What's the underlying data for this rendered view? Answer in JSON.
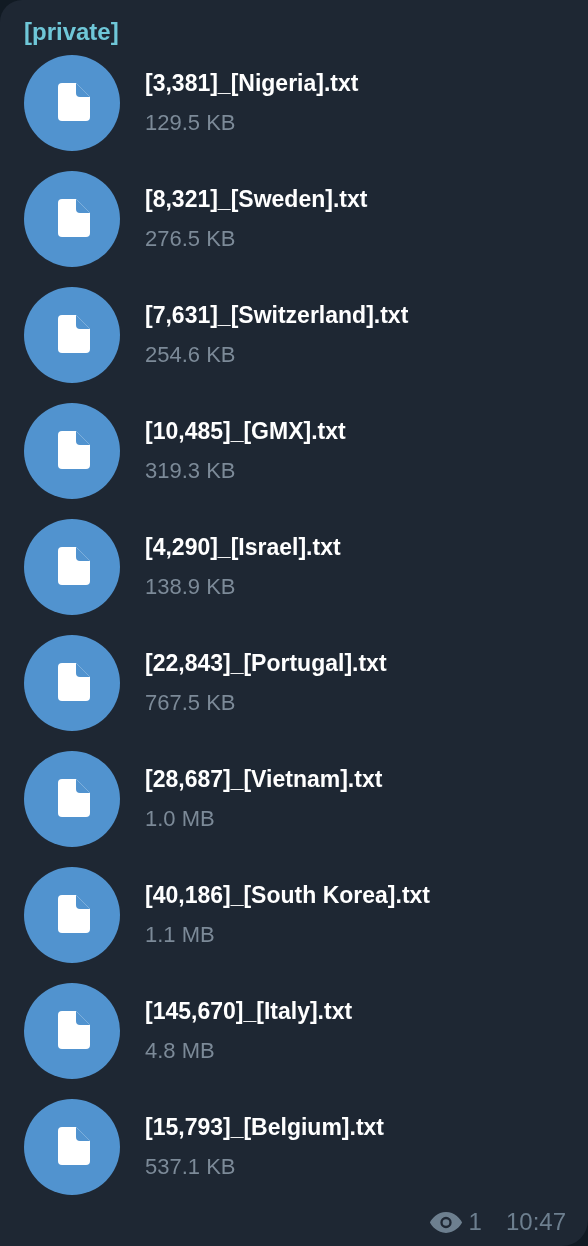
{
  "sender": "[private]",
  "files": [
    {
      "name": "[3,381]_[Nigeria].txt",
      "size": "129.5 KB"
    },
    {
      "name": "[8,321]_[Sweden].txt",
      "size": "276.5 KB"
    },
    {
      "name": "[7,631]_[Switzerland].txt",
      "size": "254.6 KB"
    },
    {
      "name": "[10,485]_[GMX].txt",
      "size": "319.3 KB"
    },
    {
      "name": "[4,290]_[Israel].txt",
      "size": "138.9 KB"
    },
    {
      "name": "[22,843]_[Portugal].txt",
      "size": "767.5 KB"
    },
    {
      "name": "[28,687]_[Vietnam].txt",
      "size": "1.0 MB"
    },
    {
      "name": "[40,186]_[South Korea].txt",
      "size": "1.1 MB"
    },
    {
      "name": "[145,670]_[Italy].txt",
      "size": "4.8 MB"
    },
    {
      "name": "[15,793]_[Belgium].txt",
      "size": "537.1 KB"
    }
  ],
  "views": "1",
  "time": "10:47"
}
